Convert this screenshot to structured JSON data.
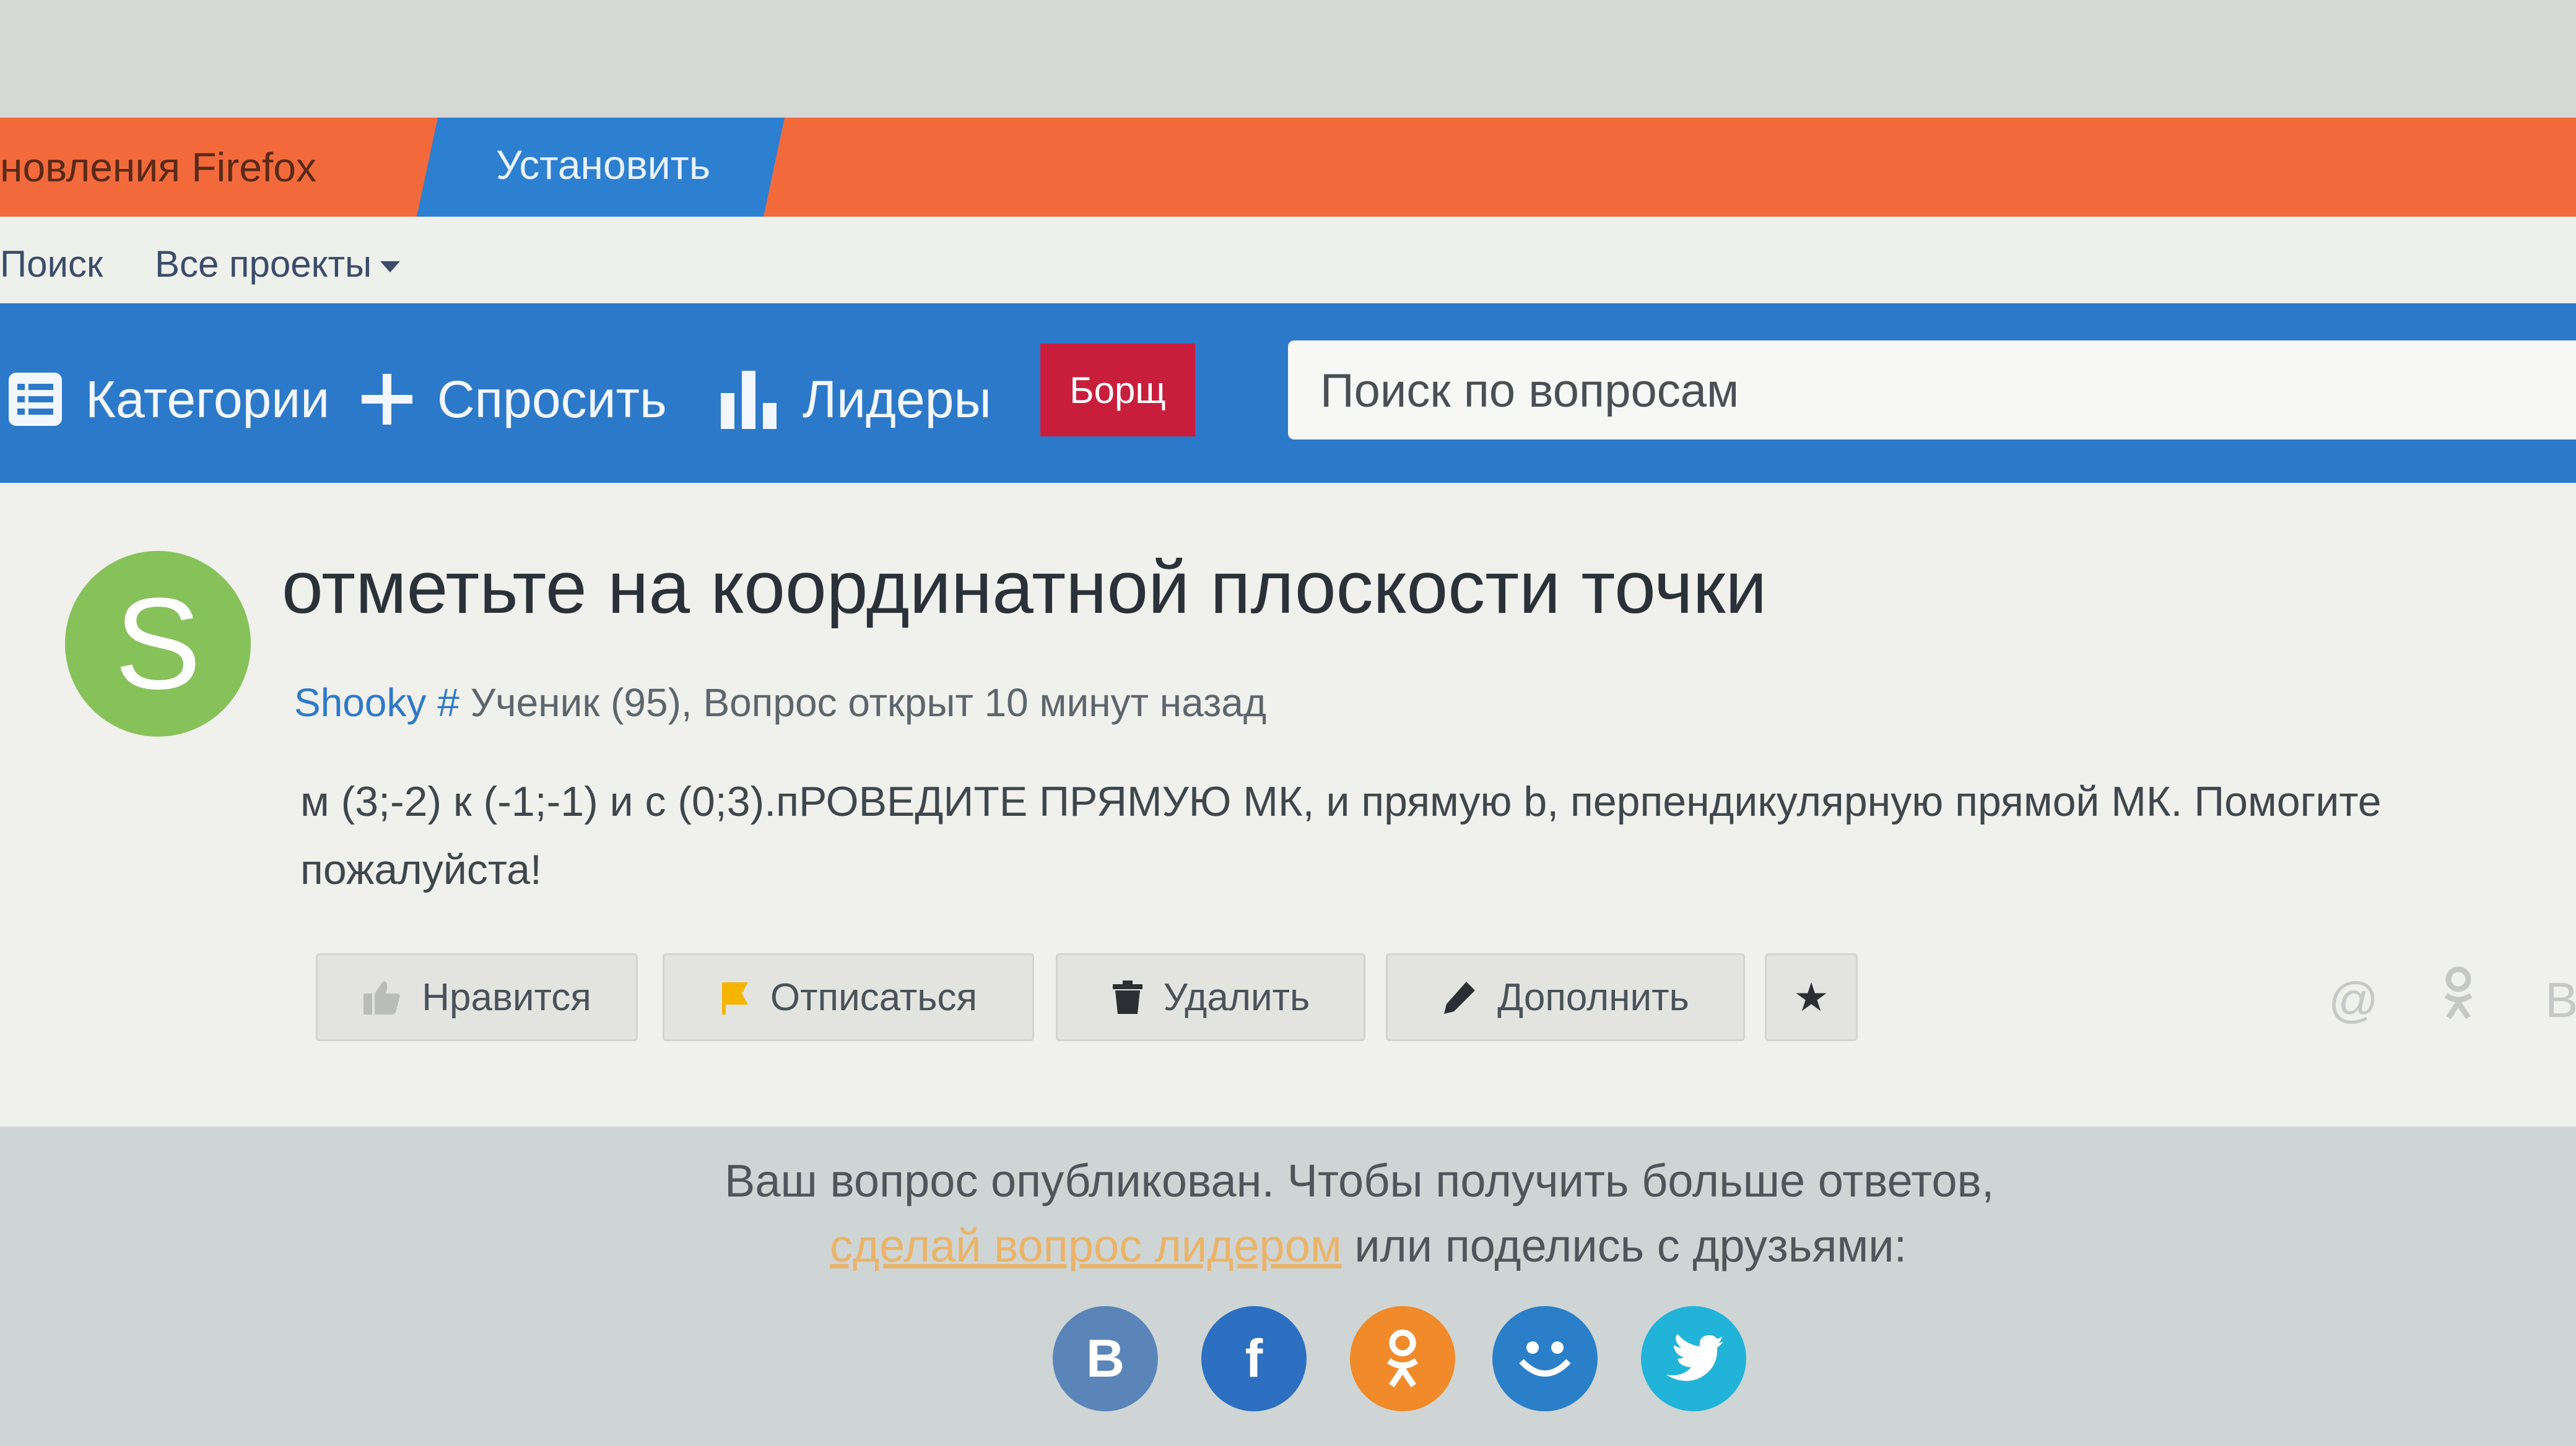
{
  "browser": {
    "update_text": "новления Firefox",
    "install_label": "Установить"
  },
  "top_links": {
    "search": "Поиск",
    "all_projects": "Все проекты"
  },
  "nav": {
    "categories": "Категории",
    "ask": "Спросить",
    "leaders": "Лидеры",
    "badge": "Борщ",
    "search_placeholder": "Поиск по вопросам"
  },
  "question": {
    "avatar_letter": "S",
    "title": "отметьте на координатной плоскости точки",
    "author": "Shooky",
    "author_hash": "#",
    "rank": "Ученик (95), Вопрос открыт 10 минут назад",
    "body_line1": "м (3;-2) к (-1;-1) и с (0;3).пРОВЕДИТЕ ПРЯМУЮ МК, и прямую b, перпендикулярную прямой МК. Помогите",
    "body_line2": "пожалуйста!"
  },
  "actions": {
    "like": "Нравится",
    "unsubscribe": "Отписаться",
    "delete": "Удалить",
    "supplement": "Дополнить"
  },
  "share_icons": {
    "at": "@",
    "ok": "ok",
    "vk": "B"
  },
  "footer": {
    "line1": "Ваш вопрос опубликован. Чтобы получить больше ответов,",
    "leader_link": "сделай вопрос лидером",
    "line2_rest": " или поделись с друзьями:",
    "vk_letter": "B",
    "fb_letter": "f"
  },
  "colors": {
    "update_bar": "#f26a3c",
    "install": "#2d7fd0",
    "nav": "#2d79c9",
    "badge": "#c81e3c",
    "avatar": "#86c15a",
    "vk": "#5b85b8",
    "facebook": "#2d6fc0",
    "odnoklassniki": "#f08a2a",
    "moimir": "#2a7fc8",
    "twitter": "#22b3d8"
  }
}
